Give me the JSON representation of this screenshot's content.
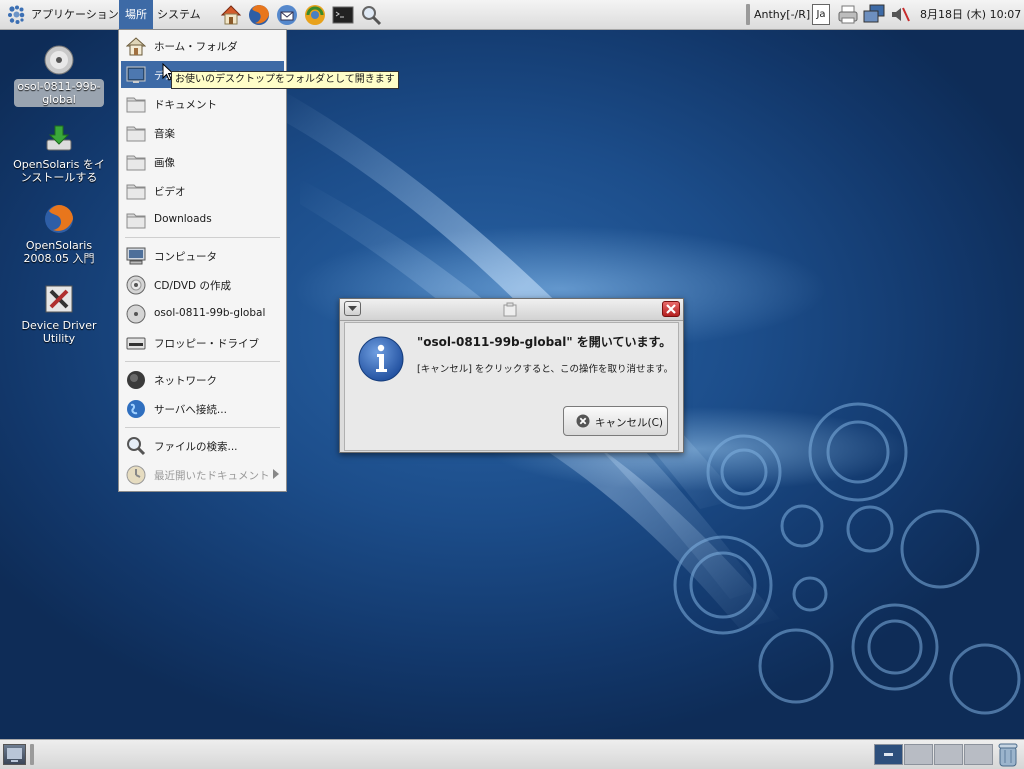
{
  "top_panel": {
    "menus": [
      {
        "label": "アプリケーション",
        "icon": "gnome-foot-icon"
      },
      {
        "label": "場所",
        "active": true
      },
      {
        "label": "システム"
      }
    ],
    "launchers": [
      "home-folder-icon",
      "firefox-icon",
      "thunderbird-icon",
      "update-manager-icon",
      "terminal-icon",
      "search-icon"
    ],
    "input_method": "Anthy[-/R]",
    "lang": "Ja",
    "clock": "8月18日 (木) 10:07"
  },
  "desktop_icons": [
    {
      "label": "osol-0811-99b-\nglobal",
      "icon": "cd-disc-icon",
      "selected": true
    },
    {
      "label": "OpenSolaris をイ\nンストールする",
      "icon": "install-icon"
    },
    {
      "label": "OpenSolaris\n2008.05 入門",
      "icon": "firefox-icon"
    },
    {
      "label": "Device Driver\nUtility",
      "icon": "device-driver-icon"
    }
  ],
  "places_menu": {
    "items": [
      {
        "label": "ホーム・フォルダ",
        "icon": "home-folder-icon"
      },
      {
        "label": "デスクトップ",
        "icon": "desktop-folder-icon",
        "hover": true
      },
      {
        "label": "ドキュメント",
        "icon": "folder-icon"
      },
      {
        "label": "音楽",
        "icon": "folder-icon"
      },
      {
        "label": "画像",
        "icon": "folder-icon"
      },
      {
        "label": "ビデオ",
        "icon": "folder-icon"
      },
      {
        "label": "Downloads",
        "icon": "folder-icon"
      },
      {
        "label": "コンピュータ",
        "icon": "computer-icon"
      },
      {
        "label": "CD/DVD の作成",
        "icon": "cd-burner-icon"
      },
      {
        "label": "osol-0811-99b-global",
        "icon": "cd-disc-icon"
      },
      {
        "label": "フロッピー・ドライブ",
        "icon": "floppy-icon"
      },
      {
        "label": "ネットワーク",
        "icon": "network-icon"
      },
      {
        "label": "サーバへ接続...",
        "icon": "globe-icon"
      },
      {
        "label": "ファイルの検索...",
        "icon": "search-icon"
      },
      {
        "label": "最近開いたドキュメント",
        "icon": "recent-documents-icon",
        "disabled": true,
        "submenu": true
      }
    ]
  },
  "tooltip": "お使いのデスクトップをフォルダとして開きます",
  "dialog": {
    "title": "\"osol-0811-99b-global\" を開いています。",
    "message": "[キャンセル] をクリックすると、この操作を取り消せます。",
    "cancel_label": "キャンセル(C)",
    "icon": "info-icon"
  },
  "colors": {
    "panel": "#dcdcdc",
    "menu_highlight": "#3d6aa6",
    "desktop_blue": "#1c4d8a",
    "close_red": "#c62b2b"
  }
}
